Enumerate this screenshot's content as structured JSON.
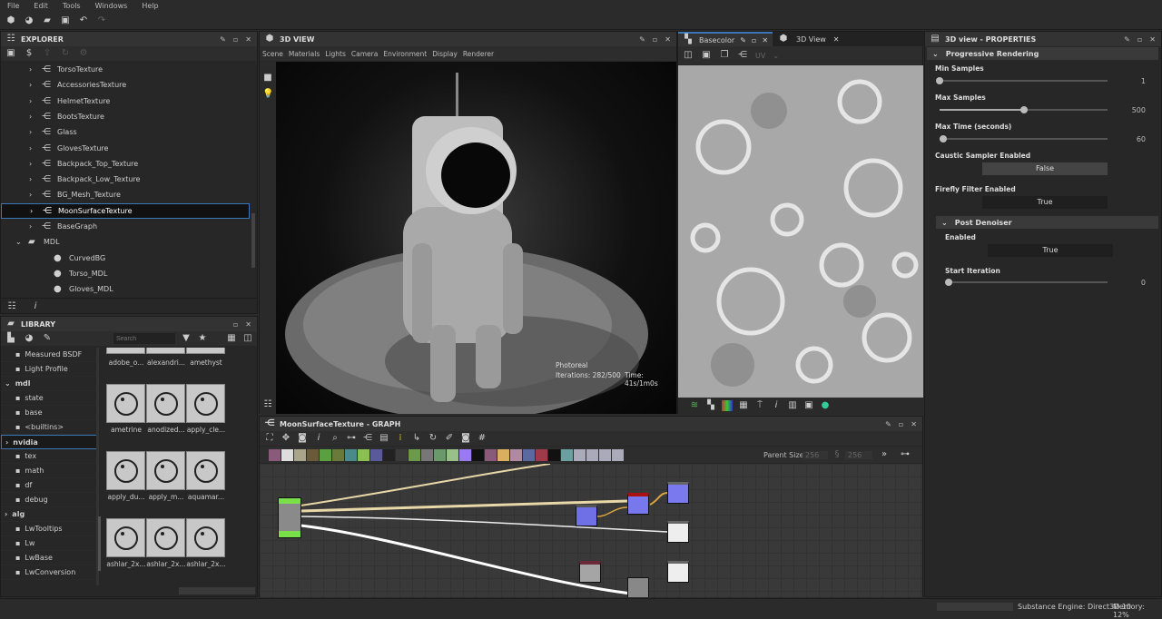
{
  "menu": [
    "File",
    "Edit",
    "Tools",
    "Windows",
    "Help"
  ],
  "explorer": {
    "title": "EXPLORER",
    "items": [
      {
        "label": "TorsoTexture",
        "type": "graph"
      },
      {
        "label": "AccessoriesTexture",
        "type": "graph"
      },
      {
        "label": "HelmetTexture",
        "type": "graph"
      },
      {
        "label": "BootsTexture",
        "type": "graph"
      },
      {
        "label": "Glass",
        "type": "graph"
      },
      {
        "label": "GlovesTexture",
        "type": "graph"
      },
      {
        "label": "Backpack_Top_Texture",
        "type": "graph"
      },
      {
        "label": "Backpack_Low_Texture",
        "type": "graph"
      },
      {
        "label": "BG_Mesh_Texture",
        "type": "graph"
      },
      {
        "label": "MoonSurfaceTexture",
        "type": "graph",
        "selected": true
      },
      {
        "label": "BaseGraph",
        "type": "graph"
      },
      {
        "label": "MDL",
        "type": "folder"
      },
      {
        "label": "CurvedBG",
        "type": "mdl"
      },
      {
        "label": "Torso_MDL",
        "type": "mdl"
      },
      {
        "label": "Gloves_MDL",
        "type": "mdl"
      }
    ]
  },
  "library": {
    "title": "LIBRARY",
    "search_placeholder": "Search",
    "tree": [
      {
        "label": "Measured BSDF"
      },
      {
        "label": "Light Profile"
      },
      {
        "label": "mdl",
        "bold": true,
        "expanded": true
      },
      {
        "label": "state"
      },
      {
        "label": "base"
      },
      {
        "label": "<builtins>"
      },
      {
        "label": "nvidia",
        "bold": true,
        "selected": true
      },
      {
        "label": "tex"
      },
      {
        "label": "math"
      },
      {
        "label": "df"
      },
      {
        "label": "debug"
      },
      {
        "label": "alg",
        "bold": true
      },
      {
        "label": "LwTooltips"
      },
      {
        "label": "Lw"
      },
      {
        "label": "LwBase"
      },
      {
        "label": "LwConversion"
      }
    ],
    "thumbs": [
      "adobe_o...",
      "alexandri...",
      "amethyst",
      "ametrine",
      "anodized...",
      "apply_cle...",
      "apply_du...",
      "apply_m...",
      "aquamar...",
      "ashlar_2x...",
      "ashlar_2x...",
      "ashlar_2x..."
    ]
  },
  "view3d": {
    "title": "3D VIEW",
    "menu": [
      "Scene",
      "Materials",
      "Lights",
      "Camera",
      "Environment",
      "Display",
      "Renderer"
    ],
    "renderer": "Photoreal",
    "iterations": "Iterations: 282/500",
    "time": "Time: 41s/1m0s"
  },
  "view2d": {
    "tabs": [
      {
        "label": "Basecolor",
        "active": true
      },
      {
        "label": "3D View"
      }
    ],
    "uv_label": "UV"
  },
  "graph": {
    "title": "MoonSurfaceTexture - GRAPH",
    "parent_size_label": "Parent Size:",
    "parent_size_w": "256",
    "parent_size_h": "256"
  },
  "properties": {
    "title": "3D view - PROPERTIES",
    "section": "Progressive Rendering",
    "min_samples": {
      "label": "Min Samples",
      "value": "1",
      "fraction": 0.0
    },
    "max_samples": {
      "label": "Max Samples",
      "value": "500",
      "fraction": 0.5
    },
    "max_time": {
      "label": "Max Time (seconds)",
      "value": "60",
      "fraction": 0.02
    },
    "caustic": {
      "label": "Caustic Sampler Enabled",
      "value": "False"
    },
    "firefly": {
      "label": "Firefly Filter Enabled",
      "value": "True"
    },
    "denoiser": {
      "title": "Post Denoiser",
      "enabled_label": "Enabled",
      "enabled_value": "True",
      "start_label": "Start Iteration",
      "start_value": "0",
      "start_fraction": 0.0
    }
  },
  "status": {
    "engine": "Substance Engine: Direct3D 10",
    "memory": "Memory: 12%"
  },
  "colors": {
    "accent": "#3a78b8",
    "panel": "#272727",
    "header": "#333333"
  }
}
